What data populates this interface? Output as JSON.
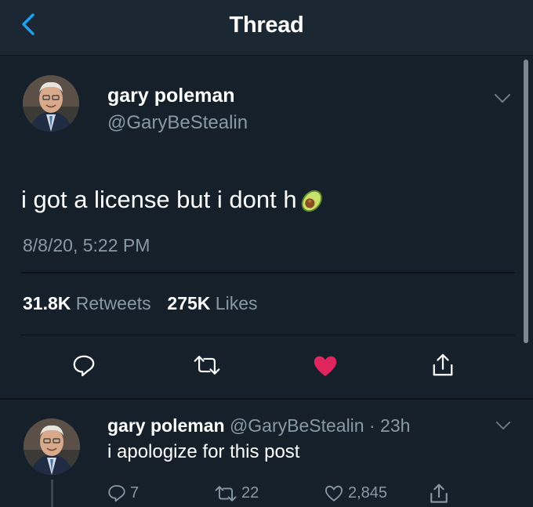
{
  "header": {
    "title": "Thread"
  },
  "main_tweet": {
    "author_name": "gary poleman",
    "author_handle": "@GaryBeStealin",
    "text": "i got a license but i dont h",
    "timestamp": "8/8/20, 5:22 PM",
    "retweets_count": "31.8K",
    "retweets_label": "Retweets",
    "likes_count": "275K",
    "likes_label": "Likes",
    "liked": true
  },
  "reply": {
    "author_name": "gary poleman",
    "author_handle": "@GaryBeStealin",
    "time": "· 23h",
    "text": "i apologize for this post",
    "reply_count": "7",
    "retweet_count": "22",
    "like_count": "2,845"
  },
  "colors": {
    "background": "#16202b",
    "header": "#1b2733",
    "accent": "#1da1f2",
    "like": "#e0245e",
    "muted_text": "#8899a6"
  },
  "icons": [
    "back-icon",
    "chevron-down-icon",
    "reply-icon",
    "retweet-icon",
    "heart-icon",
    "share-icon",
    "avocado-emoji-icon"
  ]
}
